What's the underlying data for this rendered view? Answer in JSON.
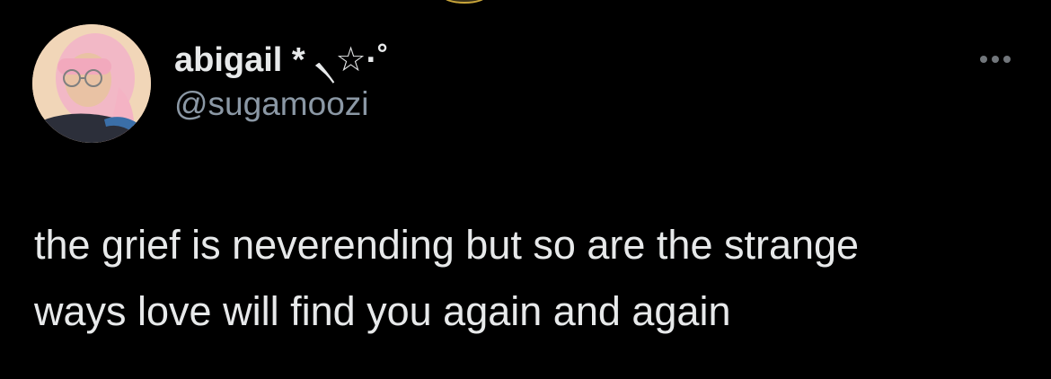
{
  "tweet": {
    "author": {
      "display_name": "abigail * ৲☆·˚",
      "handle": "@sugamoozi",
      "avatar_icon": "user-avatar-photo"
    },
    "more_icon": "more-horizontal-icon",
    "text_lines": [
      "the grief is neverending but so are the strange",
      "ways love will find you again and again"
    ]
  },
  "colors": {
    "background": "#000000",
    "primary_text": "#e7e9ea",
    "secondary_text": "#8b98a5",
    "icon_gray": "#71767b"
  }
}
